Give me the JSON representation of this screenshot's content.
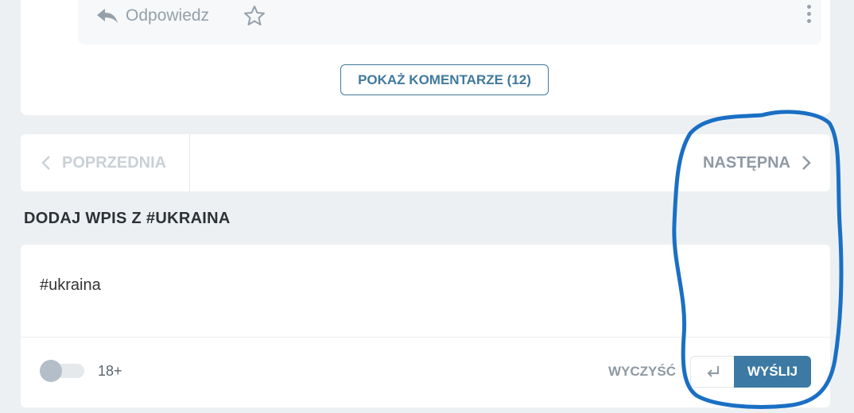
{
  "post": {
    "reply_label": "Odpowiedz",
    "star_icon": "star-icon",
    "more_icon": "more-vertical-icon",
    "show_comments_label": "POKAŻ KOMENTARZE (12)"
  },
  "pager": {
    "prev_label": "POPRZEDNIA",
    "next_label": "NASTĘPNA"
  },
  "composer": {
    "section_title": "DODAJ WPIS Z #UKRAINA",
    "text_value": "#ukraina",
    "nsfw_label": "18+",
    "clear_label": "WYCZYŚĆ",
    "send_label": "WYŚLIJ"
  },
  "colors": {
    "accent": "#3c7aa3",
    "annotation": "#1a6fc4",
    "background": "#edf0f2"
  }
}
